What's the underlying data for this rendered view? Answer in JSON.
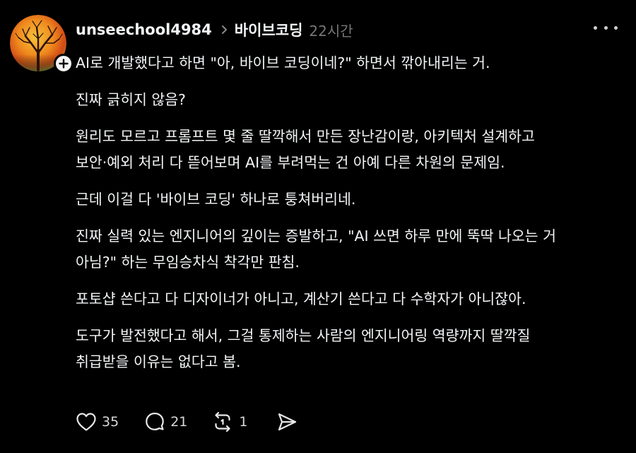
{
  "post": {
    "username": "unseechool4984",
    "topic": "바이브코딩",
    "time": "22시간",
    "paragraphs": [
      {
        "lines": [
          "AI로 개발했다고 하면 \"아, 바이브 코딩이네?\" 하면서 깎아내리는 거."
        ]
      },
      {
        "lines": [
          "진짜 긁히지 않음?"
        ]
      },
      {
        "lines": [
          "원리도 모르고 프롬프트 몇 줄 딸깍해서 만든 장난감이랑, 아키텍처 설계하고",
          "보안·예외 처리 다 뜯어보며 AI를 부려먹는 건 아예 다른 차원의 문제임."
        ]
      },
      {
        "lines": [
          "근데 이걸 다 '바이브 코딩' 하나로 퉁쳐버리네."
        ]
      },
      {
        "lines": [
          "진짜 실력 있는 엔지니어의 깊이는 증발하고, \"AI 쓰면 하루 만에 뚝딱 나오는 거",
          "아님?\" 하는 무임승차식 착각만 판침."
        ]
      },
      {
        "lines": [
          "포토샵 쓴다고 다 디자이너가 아니고, 계산기 쓴다고 다 수학자가 아니잖아."
        ]
      },
      {
        "lines": [
          "도구가 발전했다고 해서, 그걸 통제하는 사람의 엔지니어링 역량까지 딸깍질",
          "취급받을 이유는 없다고 봄."
        ]
      }
    ],
    "actions": {
      "likes": "35",
      "comments": "21",
      "reposts": "1"
    }
  },
  "icons": {
    "avatar": "tree-avatar-icon",
    "follow": "plus-icon",
    "chevron": "chevron-right-icon",
    "more": "more-horizontal-icon",
    "like": "heart-icon",
    "comment": "comment-icon",
    "repost": "repost-icon",
    "share": "send-icon"
  },
  "colors": {
    "background": "#000000",
    "text": "#f3f5f7",
    "muted": "#777777"
  }
}
